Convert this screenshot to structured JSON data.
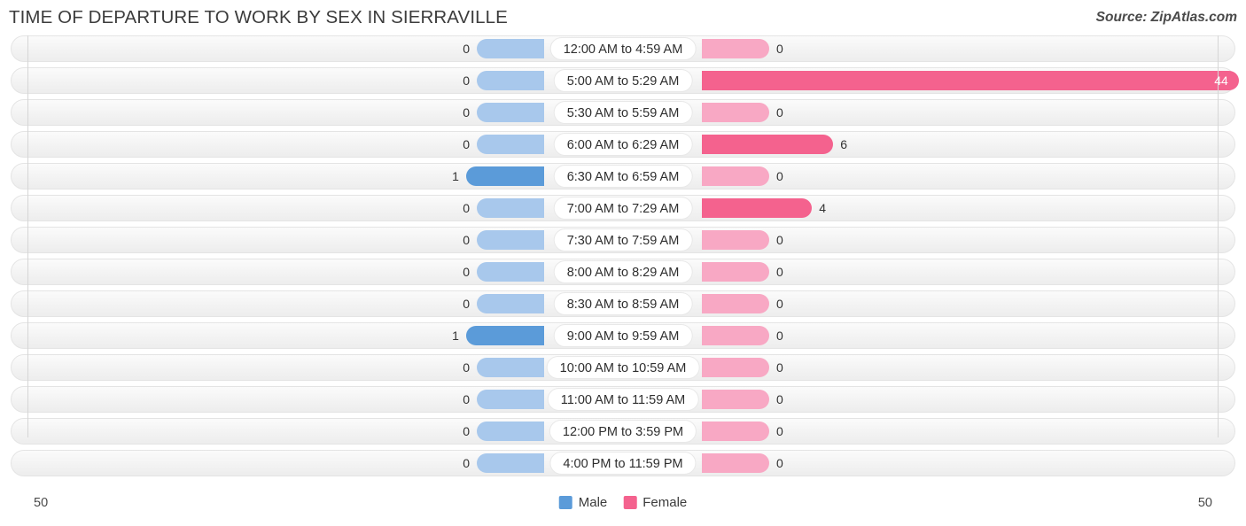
{
  "header": {
    "title": "TIME OF DEPARTURE TO WORK BY SEX IN SIERRAVILLE",
    "source": "Source: ZipAtlas.com"
  },
  "legend": {
    "male_label": "Male",
    "female_label": "Female",
    "male_color": "#5b9bd9",
    "female_color": "#f4628e"
  },
  "axis": {
    "left_tick": "50",
    "right_tick": "50"
  },
  "chart_data": {
    "type": "bar",
    "title": "TIME OF DEPARTURE TO WORK BY SEX IN SIERRAVILLE",
    "subtitle": "Source: ZipAtlas.com",
    "orientation": "horizontal-diverging",
    "xlabel": "",
    "ylabel": "",
    "xlim": [
      50,
      50
    ],
    "axis_ticks": [
      "50",
      "50"
    ],
    "grid": false,
    "legend_position": "bottom-center",
    "categories": [
      "12:00 AM to 4:59 AM",
      "5:00 AM to 5:29 AM",
      "5:30 AM to 5:59 AM",
      "6:00 AM to 6:29 AM",
      "6:30 AM to 6:59 AM",
      "7:00 AM to 7:29 AM",
      "7:30 AM to 7:59 AM",
      "8:00 AM to 8:29 AM",
      "8:30 AM to 8:59 AM",
      "9:00 AM to 9:59 AM",
      "10:00 AM to 10:59 AM",
      "11:00 AM to 11:59 AM",
      "12:00 PM to 3:59 PM",
      "4:00 PM to 11:59 PM"
    ],
    "series": [
      {
        "name": "Male",
        "color": "#5b9bd9",
        "values": [
          0,
          0,
          0,
          0,
          1,
          0,
          0,
          0,
          0,
          1,
          0,
          0,
          0,
          0
        ]
      },
      {
        "name": "Female",
        "color": "#f4628e",
        "values": [
          0,
          44,
          0,
          6,
          0,
          4,
          0,
          0,
          0,
          0,
          0,
          0,
          0,
          0
        ]
      }
    ]
  },
  "rows": [
    {
      "label": "12:00 AM to 4:59 AM",
      "male": "0",
      "female": "0"
    },
    {
      "label": "5:00 AM to 5:29 AM",
      "male": "0",
      "female": "44"
    },
    {
      "label": "5:30 AM to 5:59 AM",
      "male": "0",
      "female": "0"
    },
    {
      "label": "6:00 AM to 6:29 AM",
      "male": "0",
      "female": "6"
    },
    {
      "label": "6:30 AM to 6:59 AM",
      "male": "1",
      "female": "0"
    },
    {
      "label": "7:00 AM to 7:29 AM",
      "male": "0",
      "female": "4"
    },
    {
      "label": "7:30 AM to 7:59 AM",
      "male": "0",
      "female": "0"
    },
    {
      "label": "8:00 AM to 8:29 AM",
      "male": "0",
      "female": "0"
    },
    {
      "label": "8:30 AM to 8:59 AM",
      "male": "0",
      "female": "0"
    },
    {
      "label": "9:00 AM to 9:59 AM",
      "male": "1",
      "female": "0"
    },
    {
      "label": "10:00 AM to 10:59 AM",
      "male": "0",
      "female": "0"
    },
    {
      "label": "11:00 AM to 11:59 AM",
      "male": "0",
      "female": "0"
    },
    {
      "label": "12:00 PM to 3:59 PM",
      "male": "0",
      "female": "0"
    },
    {
      "label": "4:00 PM to 11:59 PM",
      "male": "0",
      "female": "0"
    }
  ]
}
